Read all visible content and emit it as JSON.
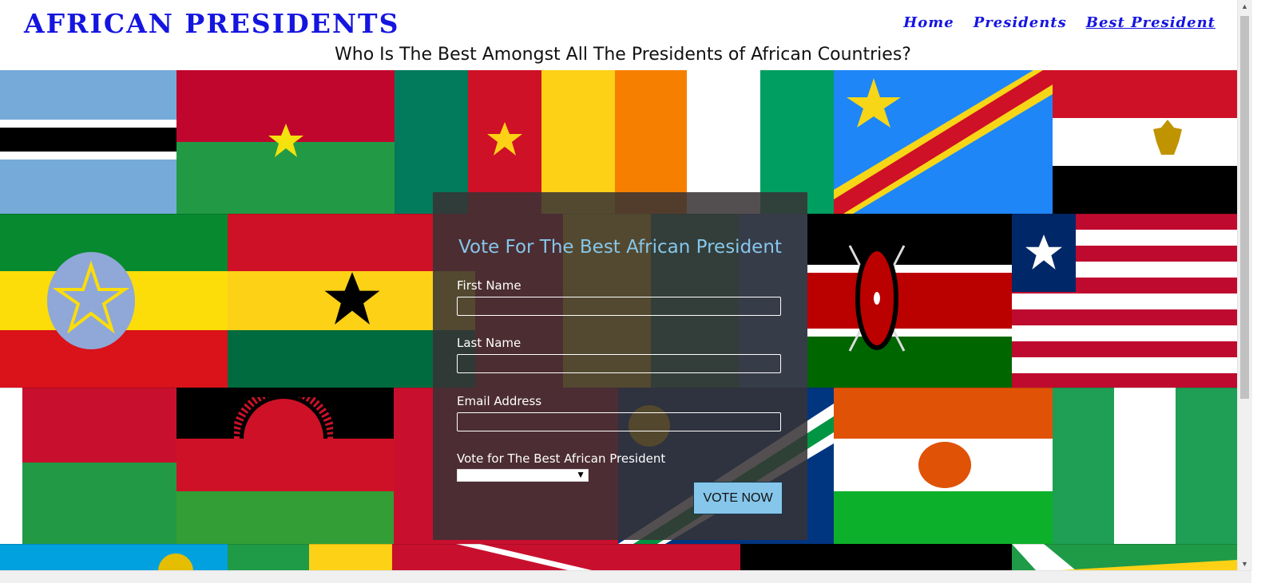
{
  "header": {
    "logo": "AFRICAN PRESIDENTS",
    "nav": [
      {
        "label": "Home"
      },
      {
        "label": "Presidents"
      },
      {
        "label": "Best President"
      }
    ],
    "active_nav": "Best President"
  },
  "subtitle": "Who Is The Best Amongst All The Presidents of African Countries?",
  "form": {
    "title": "Vote For The Best African President",
    "first_name_label": "First Name",
    "first_name_value": "",
    "last_name_label": "Last Name",
    "last_name_value": "",
    "email_label": "Email Address",
    "email_value": "",
    "vote_label": "Vote for The Best African President",
    "vote_selected": "",
    "submit_label": "VOTE NOW"
  },
  "icons": {
    "select_caret": "caret-down-icon",
    "scroll_up": "scroll-up-arrow-icon",
    "scroll_down": "scroll-down-arrow-icon"
  },
  "colors": {
    "brand_blue": "#1515e0",
    "form_title": "#86c6ea",
    "button": "#86c6ea",
    "panel_bg": "#373234"
  }
}
